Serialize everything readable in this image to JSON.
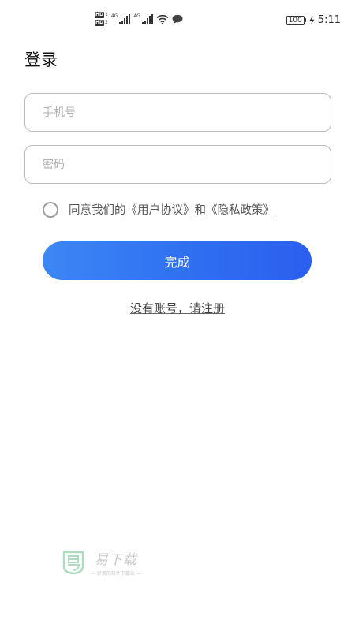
{
  "status_bar": {
    "sim1_badge": "HD",
    "sim1_num": "1",
    "sim2_badge": "HD",
    "sim2_num": "2",
    "network1": "4G",
    "network2": "4G",
    "battery": "100",
    "time": "5:11",
    "icons": [
      "signal-icon",
      "wifi-icon",
      "message-icon",
      "charging-icon"
    ]
  },
  "login": {
    "title": "登录",
    "phone_placeholder": "手机号",
    "password_placeholder": "密码",
    "agree_prefix": "同意我们的",
    "user_agreement": "《用户协议》",
    "agree_and": "和",
    "privacy_policy": "《隐私政策》",
    "submit_label": "完成",
    "register_label": "没有账号，请注册"
  },
  "watermark": {
    "brand": "易下载",
    "tagline": "— 好用的软件下载站 —"
  },
  "colors": {
    "button_start": "#3d87f5",
    "button_end": "#2b5fee",
    "field_border": "#bdbdbd",
    "watermark_green": "#9fd6b5"
  }
}
